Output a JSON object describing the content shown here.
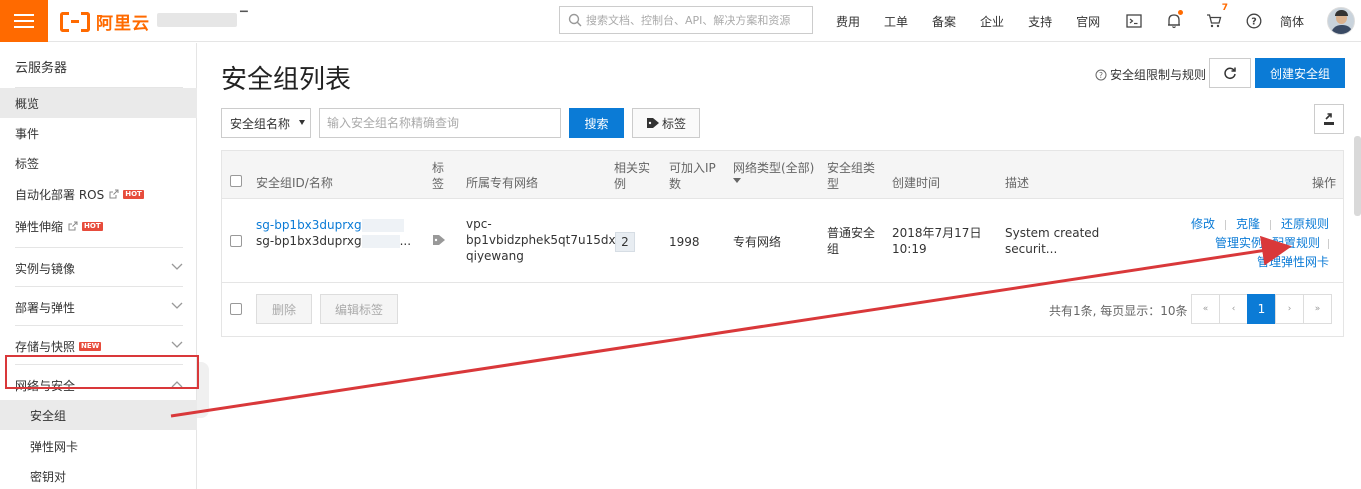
{
  "header": {
    "logo_text": "阿里云",
    "search_placeholder": "搜索文档、控制台、API、解决方案和资源",
    "nav": [
      "费用",
      "工单",
      "备案",
      "企业",
      "支持",
      "官网"
    ],
    "cart_count": "7",
    "lang": "简体",
    "colors": {
      "brand": "#ff6a00",
      "primary": "#0b7bd6",
      "annotation": "#d9383a"
    }
  },
  "sidebar": {
    "title": "云服务器",
    "items": [
      {
        "label": "概览"
      },
      {
        "label": "事件"
      },
      {
        "label": "标签"
      },
      {
        "label": "自动化部署 ROS",
        "badge": "HOT"
      },
      {
        "label": "弹性伸缩",
        "badge": "HOT"
      }
    ],
    "groups": [
      {
        "label": "实例与镜像"
      },
      {
        "label": "部署与弹性"
      },
      {
        "label": "存储与快照",
        "badge": "NEW"
      },
      {
        "label": "网络与安全"
      }
    ],
    "sub_items": [
      {
        "label": "安全组"
      },
      {
        "label": "弹性网卡"
      },
      {
        "label": "密钥对"
      }
    ]
  },
  "main": {
    "title": "安全组列表",
    "rule_link": "安全组限制与规则",
    "create_label": "创建安全组",
    "filter": {
      "select_value": "安全组名称",
      "input_placeholder": "输入安全组名称精确查询",
      "search_label": "搜索",
      "tag_label": "标签"
    },
    "table": {
      "headers": {
        "id": "安全组ID/名称",
        "tag": "标签",
        "vpc": "所属专有网络",
        "instances": "相关实例",
        "ip": "可加入IP数",
        "net_type": "网络类型(全部)",
        "sg_type": "安全组类型",
        "created": "创建时间",
        "desc": "描述",
        "ops": "操作"
      },
      "row": {
        "id": "sg-bp1bx3duprxg",
        "name": "sg-bp1bx3duprxg",
        "name_suffix": "...",
        "vpc_line1": "vpc-",
        "vpc_line2": "bp1vbidzphek5qt7u15dx",
        "vpc_line3": "qiyewang",
        "instances": "2",
        "ip": "1998",
        "net_type": "专有网络",
        "sg_type": "普通安全组",
        "created_date": "2018年7月17日",
        "created_time": "10:19",
        "desc_line1": "System created",
        "desc_line2": "securit...",
        "op_modify": "修改",
        "op_clone": "克隆",
        "op_restore": "还原规则",
        "op_manage_instances": "管理实例",
        "op_config_rules": "配置规则",
        "op_manage_eni": "管理弹性网卡"
      },
      "footer": {
        "delete_label": "删除",
        "edit_tag_label": "编辑标签",
        "page_info": "共有1条, 每页显示：10条",
        "pager": [
          "«",
          "‹",
          "1",
          "›",
          "»"
        ]
      }
    }
  }
}
